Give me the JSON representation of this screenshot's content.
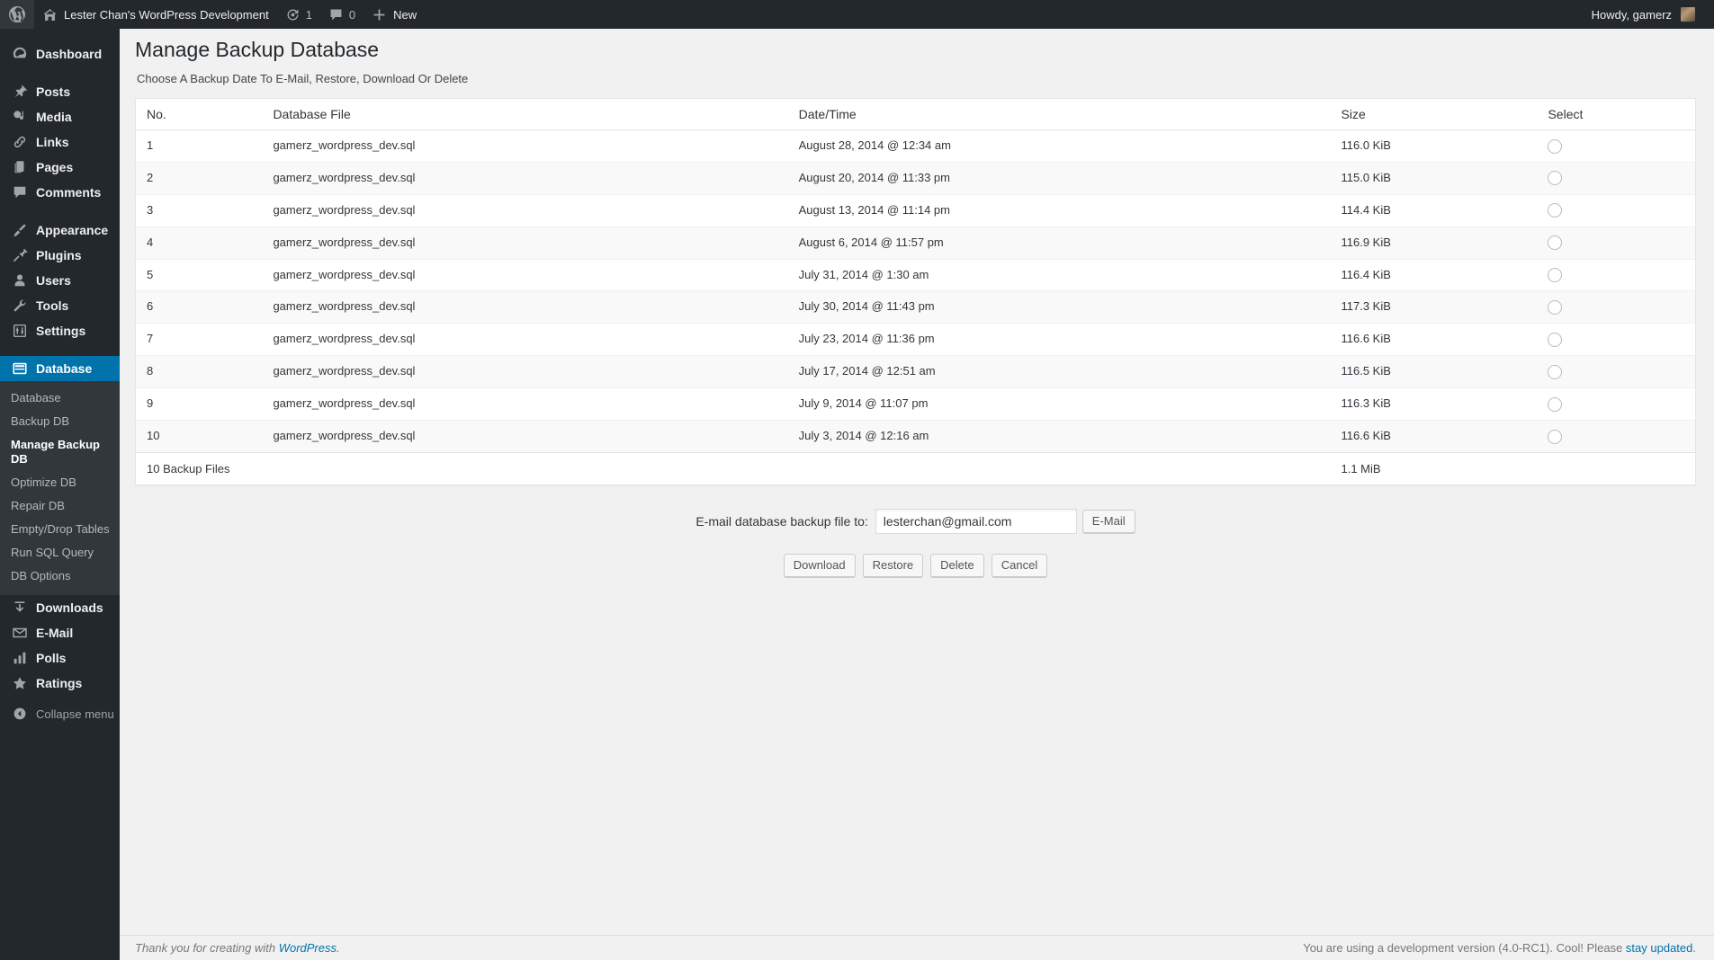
{
  "adminbar": {
    "wp_logo": "wordpress-logo",
    "site_name": "Lester Chan's WordPress Development",
    "updates_count": "1",
    "comments_count": "0",
    "new_label": "New",
    "howdy": "Howdy, gamerz"
  },
  "sidebar": {
    "items": [
      {
        "label": "Dashboard",
        "icon": "dashboard-icon",
        "current": false
      },
      {
        "label": "Posts",
        "icon": "pin-icon",
        "current": false
      },
      {
        "label": "Media",
        "icon": "media-icon",
        "current": false
      },
      {
        "label": "Links",
        "icon": "link-icon",
        "current": false
      },
      {
        "label": "Pages",
        "icon": "pages-icon",
        "current": false
      },
      {
        "label": "Comments",
        "icon": "comments-icon",
        "current": false
      },
      {
        "label": "Appearance",
        "icon": "brush-icon",
        "current": false
      },
      {
        "label": "Plugins",
        "icon": "plug-icon",
        "current": false
      },
      {
        "label": "Users",
        "icon": "user-icon",
        "current": false
      },
      {
        "label": "Tools",
        "icon": "wrench-icon",
        "current": false
      },
      {
        "label": "Settings",
        "icon": "settings-icon",
        "current": false
      },
      {
        "label": "Database",
        "icon": "database-icon",
        "current": true
      },
      {
        "label": "Downloads",
        "icon": "download-icon",
        "current": false
      },
      {
        "label": "E-Mail",
        "icon": "envelope-icon",
        "current": false
      },
      {
        "label": "Polls",
        "icon": "chart-bar-icon",
        "current": false
      },
      {
        "label": "Ratings",
        "icon": "star-icon",
        "current": false
      }
    ],
    "submenu": [
      {
        "label": "Database",
        "current": false
      },
      {
        "label": "Backup DB",
        "current": false
      },
      {
        "label": "Manage Backup DB",
        "current": true
      },
      {
        "label": "Optimize DB",
        "current": false
      },
      {
        "label": "Repair DB",
        "current": false
      },
      {
        "label": "Empty/Drop Tables",
        "current": false
      },
      {
        "label": "Run SQL Query",
        "current": false
      },
      {
        "label": "DB Options",
        "current": false
      }
    ],
    "collapse_label": "Collapse menu",
    "accent_color": "#0073aa",
    "background_color": "#23282d",
    "submenu_background": "#32373c"
  },
  "main": {
    "title": "Manage Backup Database",
    "subtitle": "Choose A Backup Date To E-Mail, Restore, Download Or Delete",
    "table": {
      "columns": [
        "No.",
        "Database File",
        "Date/Time",
        "Size",
        "Select"
      ],
      "rows": [
        {
          "no": "1",
          "file": "gamerz_wordpress_dev.sql",
          "datetime": "August 28, 2014 @ 12:34 am",
          "size": "116.0 KiB",
          "selected": false
        },
        {
          "no": "2",
          "file": "gamerz_wordpress_dev.sql",
          "datetime": "August 20, 2014 @ 11:33 pm",
          "size": "115.0 KiB",
          "selected": false
        },
        {
          "no": "3",
          "file": "gamerz_wordpress_dev.sql",
          "datetime": "August 13, 2014 @ 11:14 pm",
          "size": "114.4 KiB",
          "selected": false
        },
        {
          "no": "4",
          "file": "gamerz_wordpress_dev.sql",
          "datetime": "August 6, 2014 @ 11:57 pm",
          "size": "116.9 KiB",
          "selected": false
        },
        {
          "no": "5",
          "file": "gamerz_wordpress_dev.sql",
          "datetime": "July 31, 2014 @ 1:30 am",
          "size": "116.4 KiB",
          "selected": false
        },
        {
          "no": "6",
          "file": "gamerz_wordpress_dev.sql",
          "datetime": "July 30, 2014 @ 11:43 pm",
          "size": "117.3 KiB",
          "selected": false
        },
        {
          "no": "7",
          "file": "gamerz_wordpress_dev.sql",
          "datetime": "July 23, 2014 @ 11:36 pm",
          "size": "116.6 KiB",
          "selected": false
        },
        {
          "no": "8",
          "file": "gamerz_wordpress_dev.sql",
          "datetime": "July 17, 2014 @ 12:51 am",
          "size": "116.5 KiB",
          "selected": false
        },
        {
          "no": "9",
          "file": "gamerz_wordpress_dev.sql",
          "datetime": "July 9, 2014 @ 11:07 pm",
          "size": "116.3 KiB",
          "selected": false
        },
        {
          "no": "10",
          "file": "gamerz_wordpress_dev.sql",
          "datetime": "July 3, 2014 @ 12:16 am",
          "size": "116.6 KiB",
          "selected": false
        }
      ],
      "footer": {
        "summary": "10 Backup Files",
        "total_size": "1.1 MiB"
      }
    },
    "email_form": {
      "label": "E-mail database backup file to:",
      "value": "lesterchan@gmail.com",
      "placeholder": "",
      "button": "E-Mail"
    },
    "actions": [
      "Download",
      "Restore",
      "Delete",
      "Cancel"
    ]
  },
  "footer": {
    "left_text": "Thank you for creating with ",
    "left_link": "WordPress",
    "left_suffix": ".",
    "right_text": "You are using a development version (4.0-RC1). Cool! Please ",
    "right_link": "stay updated",
    "right_suffix": "."
  }
}
